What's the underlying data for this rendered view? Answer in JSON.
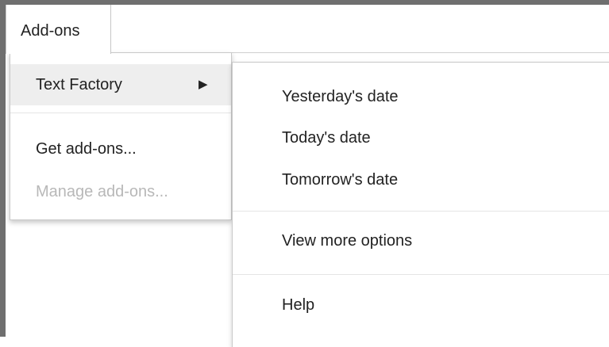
{
  "menubar": {
    "tab_label": "Add-ons"
  },
  "dropdown": {
    "items": [
      {
        "label": "Text Factory",
        "submenu_arrow": "▶",
        "highlighted": true,
        "enabled": true
      },
      {
        "label": "Get add-ons...",
        "enabled": true
      },
      {
        "label": "Manage add-ons...",
        "enabled": false
      }
    ]
  },
  "submenu": {
    "items": [
      {
        "label": "Yesterday's date"
      },
      {
        "label": "Today's date"
      },
      {
        "label": "Tomorrow's date"
      },
      {
        "label": "View more options"
      },
      {
        "label": "Help"
      }
    ]
  },
  "colors": {
    "highlight_bg": "#eeeeee",
    "disabled_text": "#b8b8b8",
    "text": "#222222",
    "border": "#c9c9c9"
  }
}
